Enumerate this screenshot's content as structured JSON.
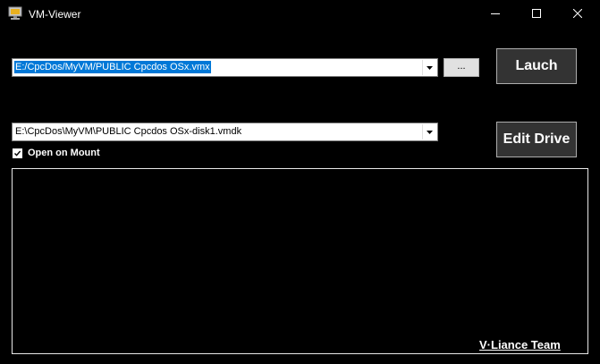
{
  "window": {
    "title": "VM-Viewer",
    "icons": {
      "app": "vm-viewer-app-icon",
      "minimize": "minimize-icon",
      "maximize": "maximize-icon",
      "close": "close-icon"
    }
  },
  "vmx_path": {
    "value": "E:/CpcDos/MyVM/PUBLIC Cpcdos OSx.vmx",
    "selected": true
  },
  "browse_button": {
    "label": "..."
  },
  "launch_button": {
    "label": "Lauch"
  },
  "vmdk_path": {
    "value": "E:\\CpcDos\\MyVM\\PUBLIC Cpcdos OSx-disk1.vmdk"
  },
  "edit_drive_button": {
    "label": "Edit Drive"
  },
  "open_on_mount": {
    "label": "Open on Mount",
    "checked": true
  },
  "output_panel": {
    "credit": "V·Liance Team"
  },
  "colors": {
    "background": "#000000",
    "selection": "#0078d7",
    "button_face": "#333333",
    "text": "#ffffff"
  }
}
